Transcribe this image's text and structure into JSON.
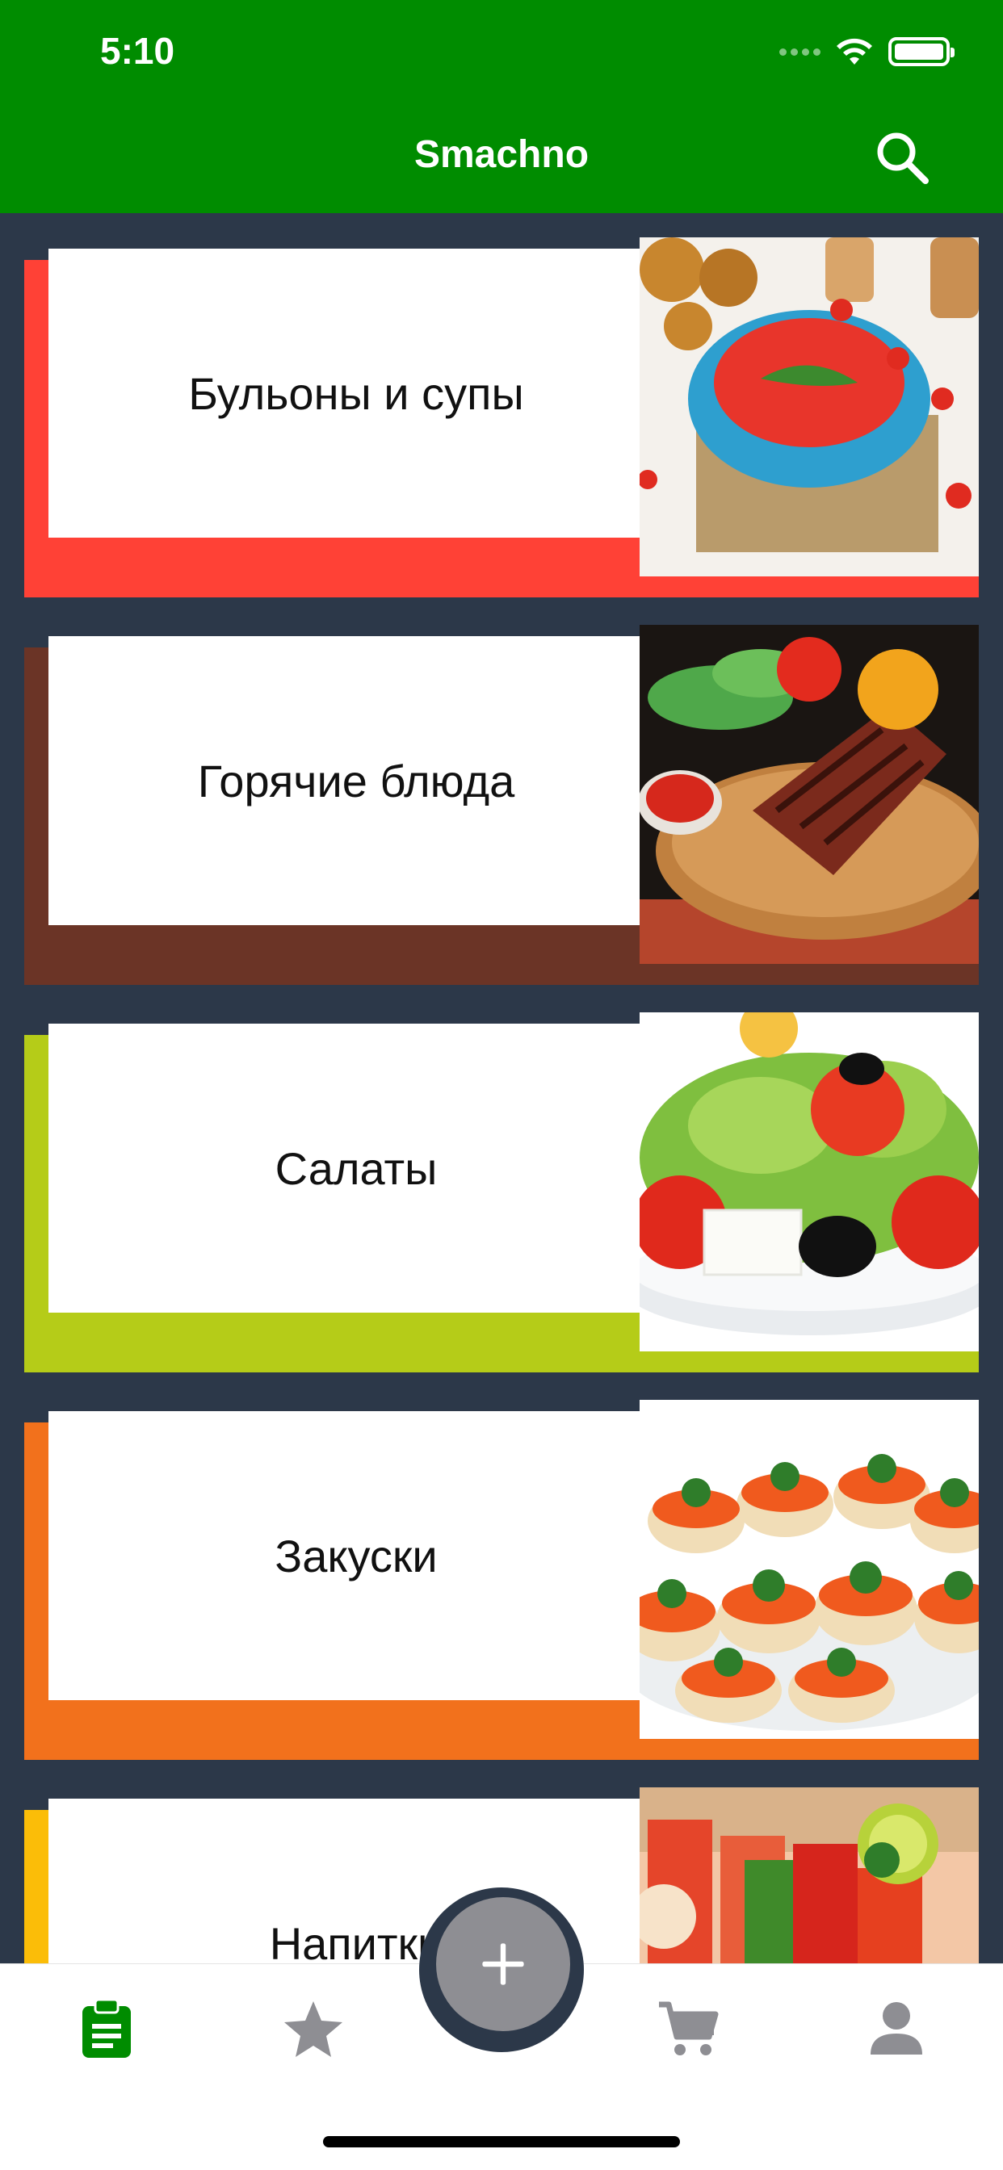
{
  "status_bar": {
    "time": "5:10"
  },
  "header": {
    "title": "Smachno",
    "search_icon": "search-icon"
  },
  "colors": {
    "header": "#008c00",
    "background": "#2c3849",
    "tab_active": "#008c00",
    "tab_inactive": "#8e8e93"
  },
  "categories": [
    {
      "label": "Бульоны и супы",
      "color": "#ff4136",
      "photo": "tomato-soup"
    },
    {
      "label": "Горячие блюда",
      "color": "#6b3426",
      "photo": "grilled-steak"
    },
    {
      "label": "Салаты",
      "color": "#b5cc18",
      "photo": "greek-salad"
    },
    {
      "label": "Закуски",
      "color": "#f2711c",
      "photo": "caviar-canapes"
    },
    {
      "label": "Напитки",
      "color": "#fbbd08",
      "photo": "juice-glasses"
    }
  ],
  "tabbar": {
    "tabs": [
      {
        "icon": "clipboard-icon",
        "active": true
      },
      {
        "icon": "star-icon",
        "active": false
      },
      {
        "icon": "cart-icon",
        "active": false
      },
      {
        "icon": "person-icon",
        "active": false
      }
    ],
    "fab_icon": "plus-icon"
  }
}
